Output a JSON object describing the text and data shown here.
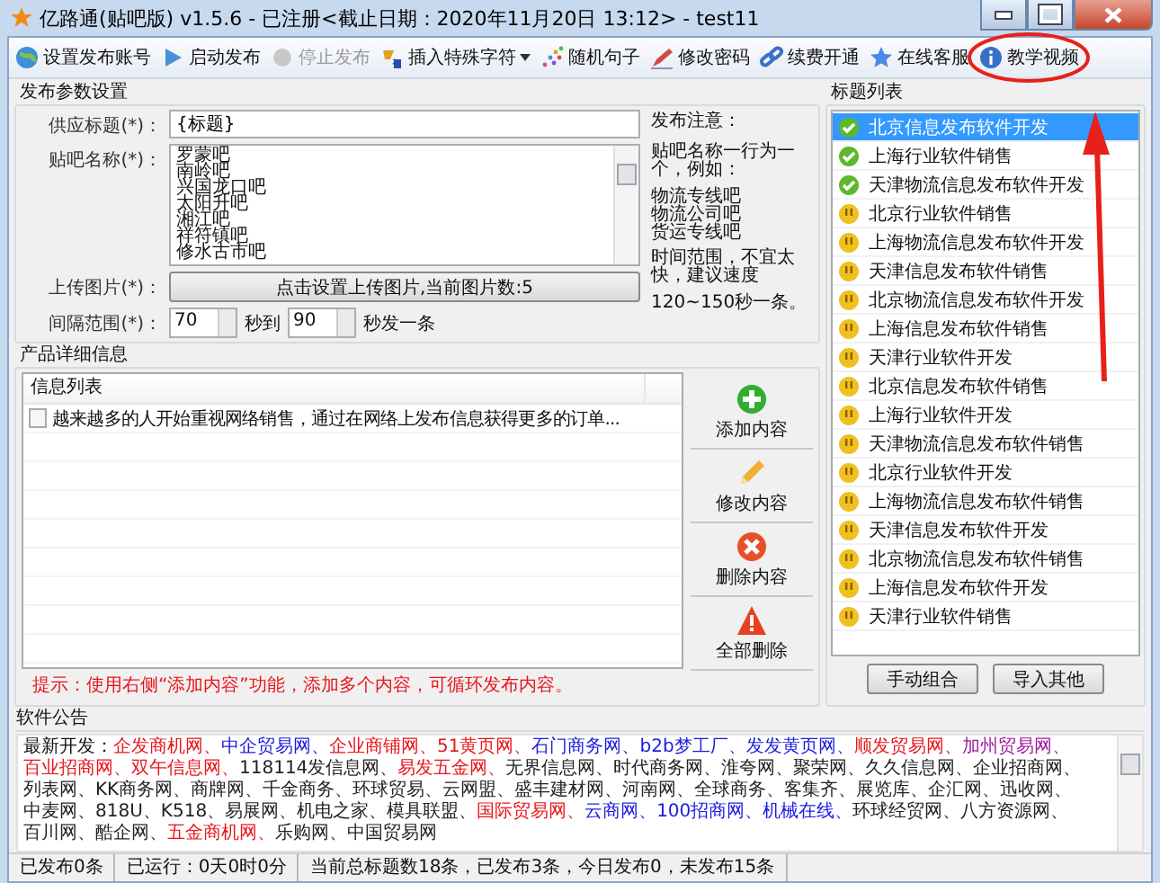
{
  "window": {
    "title": "亿路通(贴吧版) v1.5.6  - 已注册<截止日期：2020年11月20日 13:12> - test11"
  },
  "toolbar": [
    {
      "label": "设置发布账号",
      "kind": "globe",
      "disabled": false,
      "dropdown": false
    },
    {
      "label": "启动发布",
      "kind": "play",
      "disabled": false,
      "dropdown": false
    },
    {
      "label": "停止发布",
      "kind": "stop",
      "disabled": true,
      "dropdown": false
    },
    {
      "label": "插入特殊字符",
      "kind": "symbol",
      "disabled": false,
      "dropdown": true
    },
    {
      "label": "随机句子",
      "kind": "dots",
      "disabled": false,
      "dropdown": false
    },
    {
      "label": "修改密码",
      "kind": "pen",
      "disabled": false,
      "dropdown": false
    },
    {
      "label": "续费开通",
      "kind": "link",
      "disabled": false,
      "dropdown": false
    },
    {
      "label": "在线客服",
      "kind": "star",
      "disabled": false,
      "dropdown": false
    },
    {
      "label": "教学视频",
      "kind": "info",
      "disabled": false,
      "dropdown": false
    }
  ],
  "publish_settings": {
    "title": "发布参数设置",
    "supply_title": {
      "label": "供应标题(*)：",
      "value": "{标题}"
    },
    "tieba": {
      "label": "贴吧名称(*)：",
      "lines": [
        "罗蒙吧",
        "南岭吧",
        "兴国龙口吧",
        "太阳升吧",
        "湘江吧",
        "祥符镇吧",
        "修水古市吧"
      ]
    },
    "upload": {
      "label": "上传图片(*)：",
      "button": "点击设置上传图片,当前图片数:5"
    },
    "interval": {
      "label": "间隔范围(*)：",
      "from": "70",
      "to_label": "秒到",
      "to": "90",
      "unit": "秒发一条"
    },
    "notes": {
      "title": "发布注意：",
      "intro": "贴吧名称一行为一个，例如：",
      "examples": [
        "物流专线吧",
        "物流公司吧",
        "货运专线吧"
      ],
      "advice": "时间范围，不宜太快，建议速度",
      "speed": "120~150秒一条。"
    }
  },
  "product_details": {
    "title": "产品详细信息",
    "list_header": "信息列表",
    "items": [
      {
        "text": "越来越多的人开始重视网络销售，通过在网络上发布信息获得更多的订单...",
        "checked": false
      }
    ],
    "hint": "提示：使用右侧“添加内容”功能，添加多个内容，可循环发布内容。",
    "actions": [
      {
        "label": "添加内容",
        "kind": "add"
      },
      {
        "label": "修改内容",
        "kind": "edit"
      },
      {
        "label": "删除内容",
        "kind": "delete"
      },
      {
        "label": "全部删除",
        "kind": "warn"
      }
    ]
  },
  "title_list": {
    "title": "标题列表",
    "items": [
      {
        "text": "北京信息发布软件开发",
        "kind": "done",
        "selected": true
      },
      {
        "text": "上海行业软件销售",
        "kind": "done",
        "selected": false
      },
      {
        "text": "天津物流信息发布软件开发",
        "kind": "done",
        "selected": false
      },
      {
        "text": "北京行业软件销售",
        "kind": "pending",
        "selected": false
      },
      {
        "text": "上海物流信息发布软件开发",
        "kind": "pending",
        "selected": false
      },
      {
        "text": "天津信息发布软件销售",
        "kind": "pending",
        "selected": false
      },
      {
        "text": "北京物流信息发布软件开发",
        "kind": "pending",
        "selected": false
      },
      {
        "text": "上海信息发布软件销售",
        "kind": "pending",
        "selected": false
      },
      {
        "text": "天津行业软件开发",
        "kind": "pending",
        "selected": false
      },
      {
        "text": "北京信息发布软件销售",
        "kind": "pending",
        "selected": false
      },
      {
        "text": "上海行业软件开发",
        "kind": "pending",
        "selected": false
      },
      {
        "text": "天津物流信息发布软件销售",
        "kind": "pending",
        "selected": false
      },
      {
        "text": "北京行业软件开发",
        "kind": "pending",
        "selected": false
      },
      {
        "text": "上海物流信息发布软件销售",
        "kind": "pending",
        "selected": false
      },
      {
        "text": "天津信息发布软件开发",
        "kind": "pending",
        "selected": false
      },
      {
        "text": "北京物流信息发布软件销售",
        "kind": "pending",
        "selected": false
      },
      {
        "text": "上海信息发布软件开发",
        "kind": "pending",
        "selected": false
      },
      {
        "text": "天津行业软件销售",
        "kind": "pending",
        "selected": false
      }
    ],
    "buttons": [
      "手动组合",
      "导入其他"
    ]
  },
  "announcement": {
    "title": "软件公告",
    "prefix": "最新开发：",
    "sites": [
      {
        "text": "企发商机网、",
        "color": "#e8141b"
      },
      {
        "text": "中企贸易网、",
        "color": "#1a1ae0"
      },
      {
        "text": "企业商铺网、",
        "color": "#e8141b"
      },
      {
        "text": "51黄页网、",
        "color": "#e8141b"
      },
      {
        "text": "石门商务网、",
        "color": "#1a1ae0"
      },
      {
        "text": "b2b梦工厂、",
        "color": "#1a1ae0"
      },
      {
        "text": "发发黄页网、",
        "color": "#1a1ae0"
      },
      {
        "text": "顺发贸易网、",
        "color": "#e8141b"
      },
      {
        "text": "加州贸易网、",
        "color": "#9b1a9b"
      },
      {
        "text": "百业招商网、",
        "color": "#e8141b"
      },
      {
        "text": "双午信息网、",
        "color": "#e8141b"
      },
      {
        "text": "118114发信息网、",
        "color": "#222222"
      },
      {
        "text": "易发五金网、",
        "color": "#e8141b"
      },
      {
        "text": "无界信息网、",
        "color": "#222222"
      },
      {
        "text": "时代商务网、",
        "color": "#222222"
      },
      {
        "text": "淮夸网、",
        "color": "#222222"
      },
      {
        "text": "聚荣网、",
        "color": "#222222"
      },
      {
        "text": "久久信息网、",
        "color": "#222222"
      },
      {
        "text": "企业招商网、",
        "color": "#222222"
      },
      {
        "text": "列表网、",
        "color": "#222222"
      },
      {
        "text": "KK商务网、",
        "color": "#222222"
      },
      {
        "text": "商牌网、",
        "color": "#222222"
      },
      {
        "text": "千金商务、",
        "color": "#222222"
      },
      {
        "text": "环球贸易、",
        "color": "#222222"
      },
      {
        "text": "云网盟、",
        "color": "#222222"
      },
      {
        "text": "盛丰建材网、",
        "color": "#222222"
      },
      {
        "text": "河南网、",
        "color": "#222222"
      },
      {
        "text": "全球商务、",
        "color": "#222222"
      },
      {
        "text": "客集齐、",
        "color": "#222222"
      },
      {
        "text": "展览库、",
        "color": "#222222"
      },
      {
        "text": "企汇网、",
        "color": "#222222"
      },
      {
        "text": "迅收网、",
        "color": "#222222"
      },
      {
        "text": "中麦网、",
        "color": "#222222"
      },
      {
        "text": "818U、",
        "color": "#222222"
      },
      {
        "text": "K518、",
        "color": "#222222"
      },
      {
        "text": "易展网、",
        "color": "#222222"
      },
      {
        "text": "机电之家、",
        "color": "#222222"
      },
      {
        "text": "模具联盟、",
        "color": "#222222"
      },
      {
        "text": "国际贸易网、",
        "color": "#e8141b"
      },
      {
        "text": "云商网、",
        "color": "#1a1ae0"
      },
      {
        "text": "100招商网、",
        "color": "#1a1ae0"
      },
      {
        "text": "机械在线、",
        "color": "#1a1ae0"
      },
      {
        "text": "环球经贸网、",
        "color": "#222222"
      },
      {
        "text": "八方资源网、",
        "color": "#222222"
      },
      {
        "text": "百川网、",
        "color": "#222222"
      },
      {
        "text": "酷企网、",
        "color": "#222222"
      },
      {
        "text": "五金商机网、",
        "color": "#e8141b"
      },
      {
        "text": "乐购网、",
        "color": "#222222"
      },
      {
        "text": "中国贸易网",
        "color": "#222222"
      }
    ]
  },
  "status_bar": [
    "已发布0条",
    "已运行：0天0时0分",
    "当前总标题数18条，已发布3条，今日发布0，未发布15条"
  ]
}
